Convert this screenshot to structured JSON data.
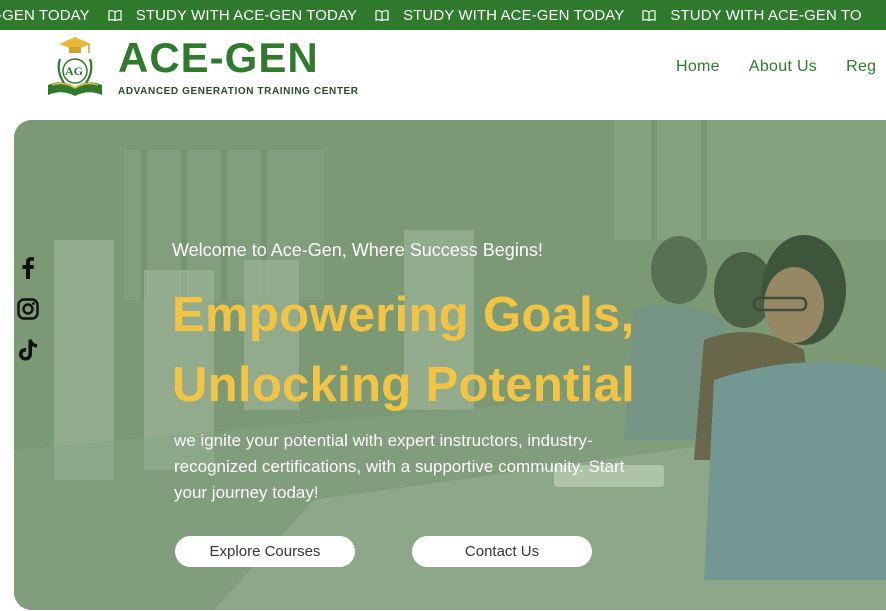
{
  "marquee": {
    "items": [
      "CE-GEN TODAY",
      "STUDY WITH ACE-GEN TODAY",
      "STUDY WITH ACE-GEN TODAY",
      "STUDY WITH ACE-GEN TO"
    ],
    "icon": "book-icon"
  },
  "brand": {
    "name": "ACE-GEN",
    "tagline": "ADVANCED GENERATION TRAINING CENTER",
    "logo_letters": "AG",
    "logo_icon": "graduation-book-logo"
  },
  "nav": {
    "items": [
      "Home",
      "About Us",
      "Reg"
    ]
  },
  "social": {
    "icons": [
      "facebook-icon",
      "instagram-icon",
      "tiktok-icon"
    ]
  },
  "hero": {
    "welcome": "Welcome to Ace-Gen, Where Success Begins!",
    "headline_line1": "Empowering Goals,",
    "headline_line2": "Unlocking Potential",
    "description": "we ignite your potential with expert instructors, industry-recognized certifications, with a supportive community. Start your journey today!",
    "buttons": {
      "explore": "Explore Courses",
      "contact": "Contact Us"
    }
  },
  "colors": {
    "brand_green": "#2f7a2c",
    "headline_yellow": "#f3c443",
    "overlay_green": "#7f9a80"
  }
}
